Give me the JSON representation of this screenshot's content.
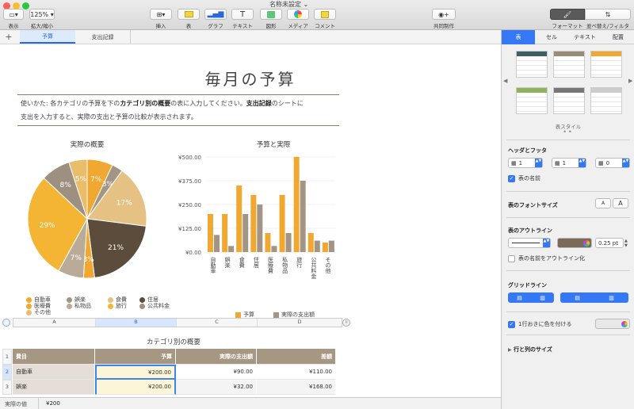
{
  "window": {
    "title": "名称未設定"
  },
  "toolbar": {
    "view": "表示",
    "zoom_value": "125%",
    "zoom": "拡大/縮小",
    "insert": "挿入",
    "table": "表",
    "chart": "グラフ",
    "text": "テキスト",
    "shape": "図形",
    "media": "メディア",
    "comment": "コメント",
    "collaborate": "共同制作",
    "format": "フォーマット",
    "sort_filter": "並べ替え/フィルタ"
  },
  "sheets": {
    "add": "+",
    "tabs": [
      "予算",
      "支出記録"
    ]
  },
  "document": {
    "title": "毎月の予算",
    "desc_1": "使いかた: 各カテゴリの予算を下の",
    "desc_bold_1": "カテゴリ別の概要",
    "desc_2": "の表に入力してください。",
    "desc_bold_2": "支出記録",
    "desc_3": "のシートに",
    "desc_line2": "支出を入力すると、実際の支出と予算の比較が表示されます。"
  },
  "chart_data": [
    {
      "type": "pie",
      "title": "実際の概要",
      "categories": [
        "自動車",
        "娯楽",
        "食費",
        "住居",
        "医療費",
        "私物品",
        "旅行",
        "公共料金",
        "その他"
      ],
      "labels": [
        "7%",
        "3%",
        "17%",
        "21%",
        "3%",
        "7%",
        "29%",
        "8%",
        "5%"
      ],
      "values": [
        7,
        3,
        17,
        21,
        3,
        7,
        29,
        8,
        5
      ]
    },
    {
      "type": "bar",
      "title": "予算と実際",
      "categories": [
        "自動車",
        "娯楽",
        "食費",
        "住居",
        "医療費",
        "私物品",
        "旅行",
        "公共料金",
        "その他"
      ],
      "series": [
        {
          "name": "予算",
          "values": [
            200,
            200,
            350,
            300,
            100,
            300,
            500,
            100,
            50
          ]
        },
        {
          "name": "実際の支出額",
          "values": [
            90,
            32,
            200,
            250,
            32,
            100,
            375,
            60,
            60
          ]
        }
      ],
      "yticks": [
        "¥500.00",
        "¥375.00",
        "¥250.00",
        "¥125.00",
        "¥0.00"
      ],
      "ylim": [
        0,
        500
      ]
    }
  ],
  "colors": {
    "orange": "#f0a830",
    "gray": "#a29585",
    "panel_accent": "#3478f6",
    "header_brown": "#a59782"
  },
  "column_headers": [
    "A",
    "B",
    "C",
    "D"
  ],
  "table": {
    "title": "カテゴリ別の概要",
    "headers": [
      "費目",
      "予算",
      "実際の支出額",
      "差額"
    ],
    "rows": [
      {
        "num": "2",
        "cells": [
          "自動車",
          "¥200.00",
          "¥90.00",
          "¥110.00"
        ]
      },
      {
        "num": "3",
        "cells": [
          "娯楽",
          "¥200.00",
          "¥32.00",
          "¥168.00"
        ]
      }
    ],
    "row_numbers": [
      "1",
      "2",
      "3"
    ]
  },
  "status": {
    "label": "実際の値",
    "value": "¥200"
  },
  "panel": {
    "tabs": [
      "表",
      "セル",
      "テキスト",
      "配置"
    ],
    "table_styles": "表スタイル",
    "header_footer": "ヘッダとフッタ",
    "header_rows": "1",
    "header_cols": "1",
    "footer_rows": "0",
    "table_name": "表の名前",
    "font_size": "表のフォントサイズ",
    "font_small": "A",
    "font_large": "A",
    "outline": "表のアウトライン",
    "outline_width": "0.25 pt",
    "outline_name": "表の名前をアウトライン化",
    "gridlines": "グリッドライン",
    "alternate": "1行おきに色を付ける",
    "row_col_size": "行と列のサイズ"
  }
}
